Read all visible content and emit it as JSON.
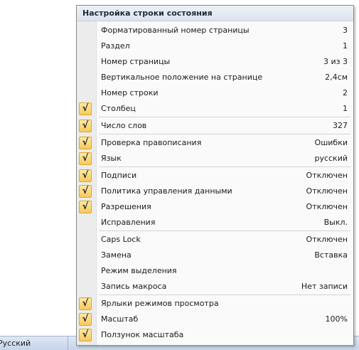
{
  "status_bar": {
    "language": "Русский"
  },
  "menu": {
    "title": "Настройка строки состояния",
    "items": [
      {
        "label": "Форматированный номер страницы",
        "value": "3",
        "checked": false
      },
      {
        "label": "Раздел",
        "value": "1",
        "checked": false
      },
      {
        "label": "Номер страницы",
        "value": "3 из 3",
        "checked": false
      },
      {
        "label": "Вертикальное положение на странице",
        "value": "2,4см",
        "checked": false
      },
      {
        "label": "Номер строки",
        "value": "2",
        "checked": false
      },
      {
        "label": "Столбец",
        "value": "1",
        "checked": true
      },
      {
        "label": "Число слов",
        "value": "327",
        "checked": true
      },
      {
        "label": "Проверка правописания",
        "value": "Ошибки",
        "checked": true
      },
      {
        "label": "Язык",
        "value": "русский",
        "checked": true
      },
      {
        "label": "Подписи",
        "value": "Отключен",
        "checked": true
      },
      {
        "label": "Политика управления данными",
        "value": "Отключен",
        "checked": true
      },
      {
        "label": "Разрешения",
        "value": "Отключен",
        "checked": true
      },
      {
        "label": "Исправления",
        "value": "Выкл.",
        "checked": false
      },
      {
        "label": "Caps Lock",
        "value": "Отключен",
        "checked": false
      },
      {
        "label": "Замена",
        "value": "Вставка",
        "checked": false
      },
      {
        "label": "Режим выделения",
        "value": "",
        "checked": false
      },
      {
        "label": "Запись макроса",
        "value": "Нет записи",
        "checked": false
      },
      {
        "label": "Ярлыки режимов просмотра",
        "value": "",
        "checked": true
      },
      {
        "label": "Масштаб",
        "value": "100%",
        "checked": true
      },
      {
        "label": "Ползунок масштаба",
        "value": "",
        "checked": true
      }
    ]
  },
  "colors": {
    "check_bg": "#f8c95a",
    "menu_bg": "#fafafa"
  },
  "icons": {
    "check": "checkmark-icon"
  }
}
